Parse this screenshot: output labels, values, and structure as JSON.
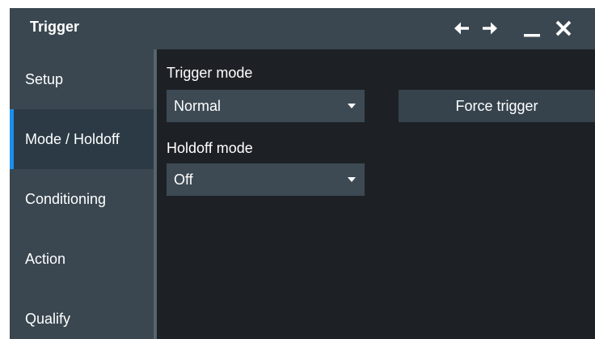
{
  "window": {
    "title": "Trigger",
    "controls": [
      "arrow-left-icon",
      "arrow-right-icon",
      "minimize-icon",
      "close-icon"
    ]
  },
  "sidebar": {
    "items": [
      {
        "label": "Setup",
        "active": false
      },
      {
        "label": "Mode / Holdoff",
        "active": true
      },
      {
        "label": "Conditioning",
        "active": false
      },
      {
        "label": "Action",
        "active": false
      },
      {
        "label": "Qualify",
        "active": false
      }
    ]
  },
  "main": {
    "trigger_mode": {
      "label": "Trigger mode",
      "value": "Normal"
    },
    "force_trigger": {
      "label": "Force trigger"
    },
    "holdoff_mode": {
      "label": "Holdoff mode",
      "value": "Off"
    }
  },
  "colors": {
    "accent": "#1a90ee",
    "panel": "#1d2126",
    "sidebar": "#3a4750"
  }
}
